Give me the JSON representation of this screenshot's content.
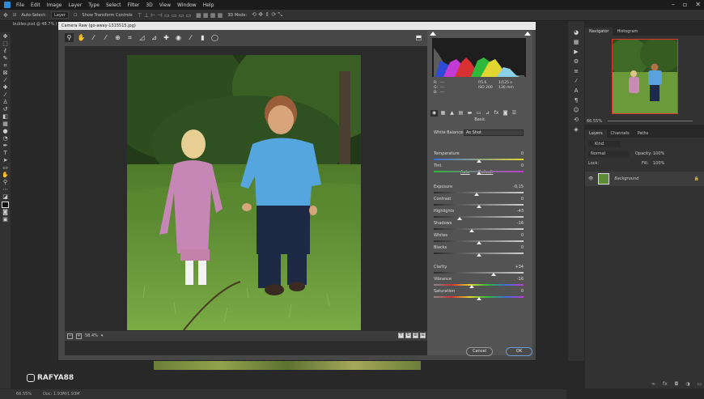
{
  "menubar": {
    "items": [
      "File",
      "Edit",
      "Image",
      "Layer",
      "Type",
      "Select",
      "Filter",
      "3D",
      "View",
      "Window",
      "Help"
    ]
  },
  "options_bar": {
    "auto_select_label": "Auto-Select:",
    "auto_select_value": "Layer",
    "transform_label": "Show Transform Controls",
    "mode_label": "3D Mode:"
  },
  "document_tab": "bubles.psd @ 48.7% (Background, RGB/8)",
  "status_bar": {
    "zoom": "66.55%",
    "doc": "Doc: 1.93M/1.93M"
  },
  "watermark": "RAFYA88",
  "dialog": {
    "title": "Camera Raw (go-away-1315515.jpg)",
    "zoom": "58.4%",
    "info": {
      "r": "R:",
      "g": "G:",
      "b": "B:",
      "r_val": "---",
      "g_val": "---",
      "b_val": "---",
      "aperture": "f/5.6",
      "shutter": "1/125 s",
      "iso": "ISO 200",
      "focal": "130 mm"
    },
    "panel_title": "Basic",
    "white_balance_label": "White Balance:",
    "white_balance_value": "As Shot",
    "auto_label": "Auto",
    "default_label": "Default",
    "sliders": [
      {
        "label": "Temperature",
        "value": "0",
        "pos": 0.5
      },
      {
        "label": "Tint",
        "value": "0",
        "pos": 0.5
      },
      {
        "label": "Exposure",
        "value": "-0,15",
        "pos": 0.48
      },
      {
        "label": "Contrast",
        "value": "0",
        "pos": 0.5
      },
      {
        "label": "Highlights",
        "value": "-43",
        "pos": 0.29
      },
      {
        "label": "Shadows",
        "value": "-16",
        "pos": 0.42
      },
      {
        "label": "Whites",
        "value": "0",
        "pos": 0.5
      },
      {
        "label": "Blacks",
        "value": "0",
        "pos": 0.5
      },
      {
        "label": "Clarity",
        "value": "+34",
        "pos": 0.67
      },
      {
        "label": "Vibrance",
        "value": "-16",
        "pos": 0.42
      },
      {
        "label": "Saturation",
        "value": "0",
        "pos": 0.5
      }
    ],
    "cancel_label": "Cancel",
    "ok_label": "OK"
  },
  "navigator": {
    "tabs": [
      "Navigator",
      "Histogram"
    ],
    "zoom": "66.55%"
  },
  "layers": {
    "tabs": [
      "Layers",
      "Channels",
      "Paths"
    ],
    "kind": "Kind",
    "blend": "Normal",
    "opacity_label": "Opacity:",
    "opacity": "100%",
    "lock_label": "Lock:",
    "fill_label": "Fill:",
    "fill": "100%",
    "layer_name": "Background"
  },
  "colors": {
    "accent": "#2e8bd8",
    "dialog_bg": "#474747",
    "panel_bg": "#323232"
  }
}
